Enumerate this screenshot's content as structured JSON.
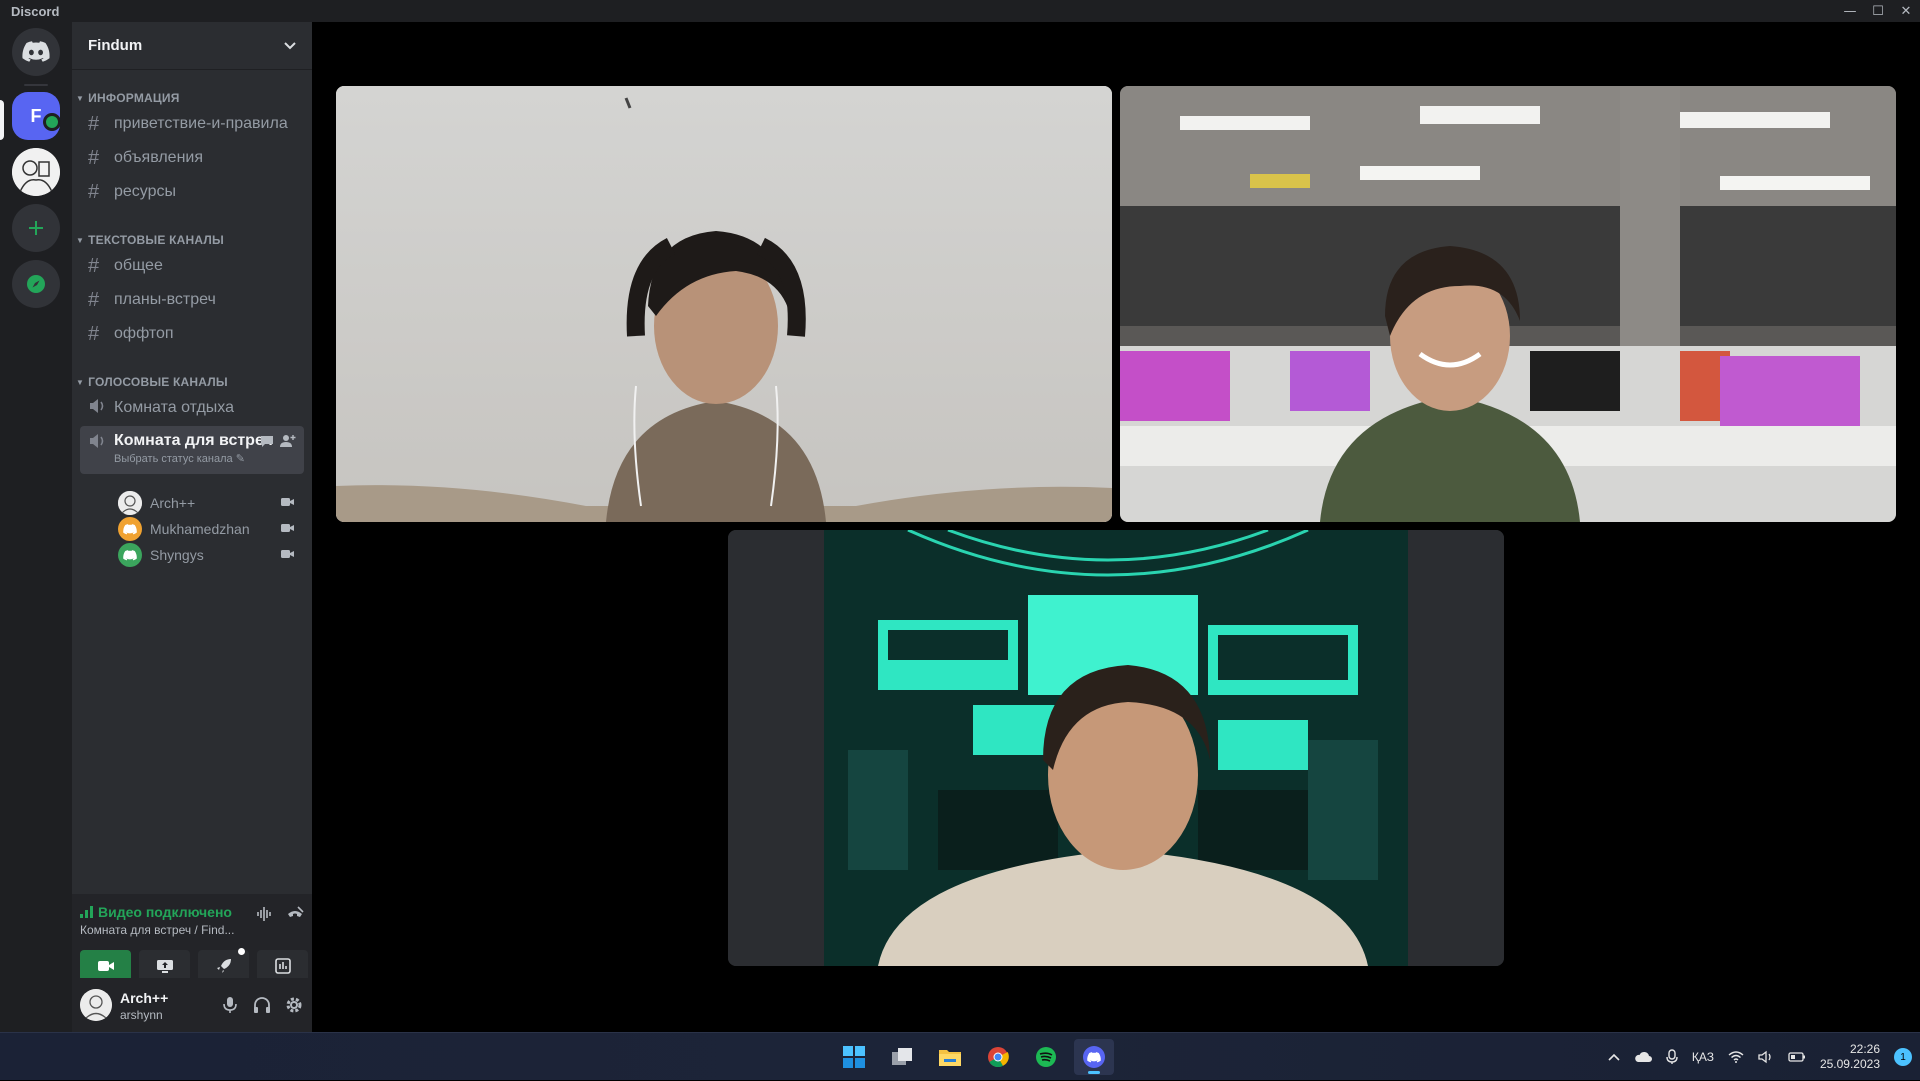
{
  "app": {
    "title": "Discord",
    "window_controls": [
      "—",
      "☐",
      "✕"
    ]
  },
  "rail": {
    "active_server_letter": "F"
  },
  "guild": {
    "name": "Findum"
  },
  "categories": [
    {
      "name": "ИНФОРМАЦИЯ",
      "channels": [
        "приветствие-и-правила",
        "объявления",
        "ресурсы"
      ]
    },
    {
      "name": "ТЕКСТОВЫЕ КАНАЛЫ",
      "channels": [
        "общее",
        "планы-встреч",
        "оффтоп"
      ]
    },
    {
      "name": "ГОЛОСОВЫЕ КАНАЛЫ",
      "channels": [
        "Комната отдыха",
        "Комната для встреч"
      ]
    }
  ],
  "active_voice": {
    "status_hint": "Выбрать статус канала"
  },
  "voice_users": [
    {
      "name": "Arch++",
      "avatar_color": "#d9d9d9"
    },
    {
      "name": "Mukhamedzhan",
      "avatar_color": "#f0a231"
    },
    {
      "name": "Shyngys",
      "avatar_color": "#3ba55d"
    }
  ],
  "voice_panel": {
    "status": "Видео подключено",
    "channel": "Комната для встреч / Find..."
  },
  "user": {
    "display_name": "Arch++",
    "username": "arshynn"
  },
  "taskbar": {
    "lang": "ҚАЗ",
    "time": "22:26",
    "date": "25.09.2023",
    "notifications": "1"
  },
  "colors": {
    "accent": "#5865f2",
    "green": "#23a559",
    "sidebar": "#2b2d31"
  }
}
